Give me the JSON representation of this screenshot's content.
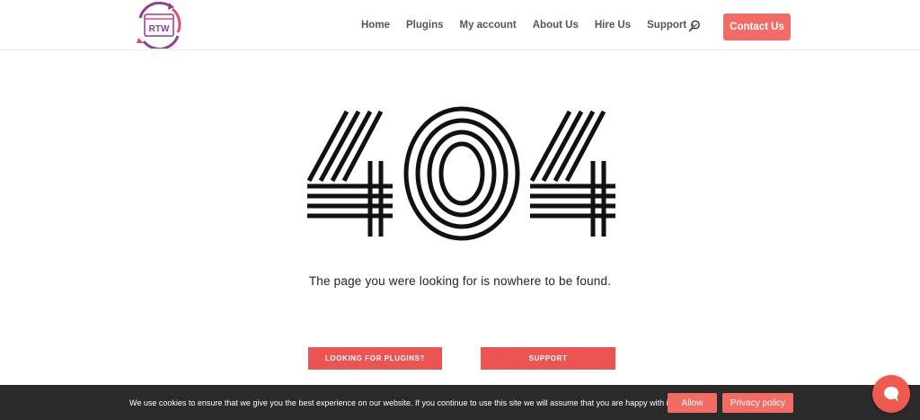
{
  "colors": {
    "accent": "#f26b64",
    "cta": "#ea5453",
    "cookie_bar": "#2b2b2b",
    "logo_purple": "#8e3f96",
    "logo_pink": "#e04d7a"
  },
  "header": {
    "logo_text": "RTW",
    "nav": [
      {
        "label": "Home"
      },
      {
        "label": "Plugins"
      },
      {
        "label": "My account"
      },
      {
        "label": "About Us"
      },
      {
        "label": "Hire Us"
      },
      {
        "label": "Support"
      }
    ],
    "search_icon": "search-icon",
    "contact_label": "Contact Us"
  },
  "error": {
    "code": "404",
    "message": "The page you were looking for is nowhere to be found."
  },
  "cta": {
    "plugins_label": "LOOKING FOR PLUGINS?",
    "support_label": "SUPPORT"
  },
  "cookie": {
    "text": "We use cookies to ensure that we give you the best experience on our website. If you continue to use this site we will assume that you are happy with it.",
    "allow_label": "Allow",
    "privacy_label": "Privacy policy"
  },
  "chat": {
    "icon": "chat-bubble-icon"
  }
}
